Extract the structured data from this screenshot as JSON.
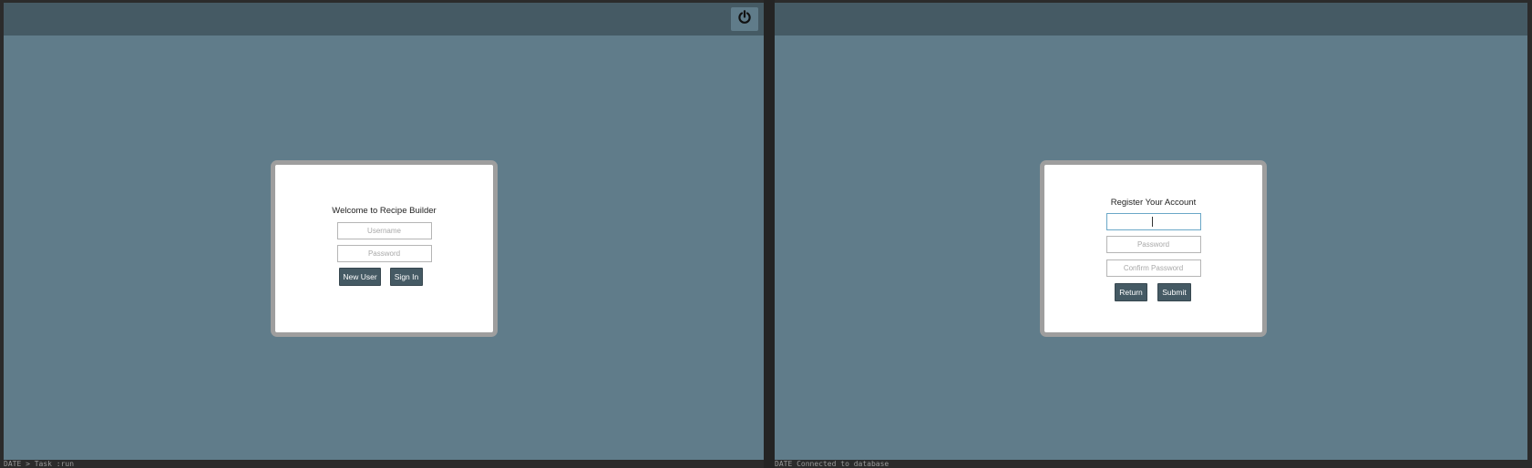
{
  "login": {
    "title": "Welcome to Recipe Builder",
    "username_placeholder": "Username",
    "password_placeholder": "Password",
    "new_user_label": "New User",
    "sign_in_label": "Sign In"
  },
  "register": {
    "title": "Register Your Account",
    "username_value": "",
    "password_placeholder": "Password",
    "confirm_password_placeholder": "Confirm Password",
    "return_label": "Return",
    "submit_label": "Submit"
  },
  "toolbar": {
    "power_icon": "power-icon"
  },
  "status": {
    "left_text": "DATE                    > Task :run",
    "right_text": "DATE                    Connected to database"
  },
  "colors": {
    "background": "#607c8a",
    "titlebar": "#455a64",
    "button": "#455a64",
    "card_border": "#9e9e9e"
  }
}
